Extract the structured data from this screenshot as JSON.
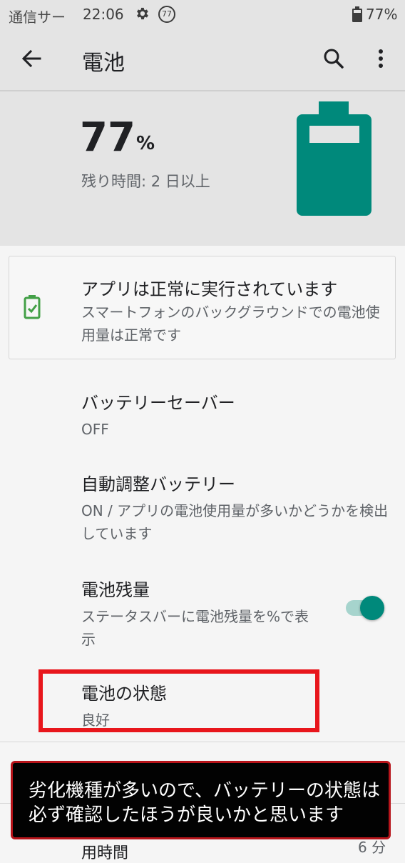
{
  "status_bar": {
    "carrier": "通信サー",
    "time": "22:06",
    "badge": "77",
    "battery_pct": "77%"
  },
  "app_bar": {
    "title": "電池",
    "icons": [
      "back-arrow-icon",
      "search-icon",
      "more-vert-icon"
    ]
  },
  "header": {
    "level_value": "77",
    "level_unit": "%",
    "remaining": "残り時間: 2 日以上",
    "battery_color": "#00897b",
    "battery_fill": 0.77
  },
  "tip": {
    "title": "アプリは正常に実行されています",
    "body": "スマートフォンのバックグラウンドでの電池使用量は正常です",
    "icon": "battery-check-icon",
    "icon_color": "#43a047"
  },
  "prefs": {
    "battery_saver": {
      "title": "バッテリーセーバー",
      "summary": "OFF"
    },
    "adaptive": {
      "title": "自動調整バッテリー",
      "summary": "ON / アプリの電池使用量が多いかどうかを検出しています"
    },
    "percentage": {
      "title": "電池残量",
      "summary": "ステータスバーに電池残量を%で表示",
      "toggle_on": true
    },
    "health": {
      "title": "電池の状態",
      "summary": "良好"
    }
  },
  "partial_below": {
    "left": "用時間",
    "right": "6 分"
  },
  "annotation": {
    "text": "劣化機種が多いので、バッテリーの状態は必ず確認したほうが良いかと思います",
    "highlight_color": "#e8161c"
  },
  "colors": {
    "accent": "#00897b",
    "background": "#f5f5f5",
    "header_bg": "#e4e4e4"
  }
}
